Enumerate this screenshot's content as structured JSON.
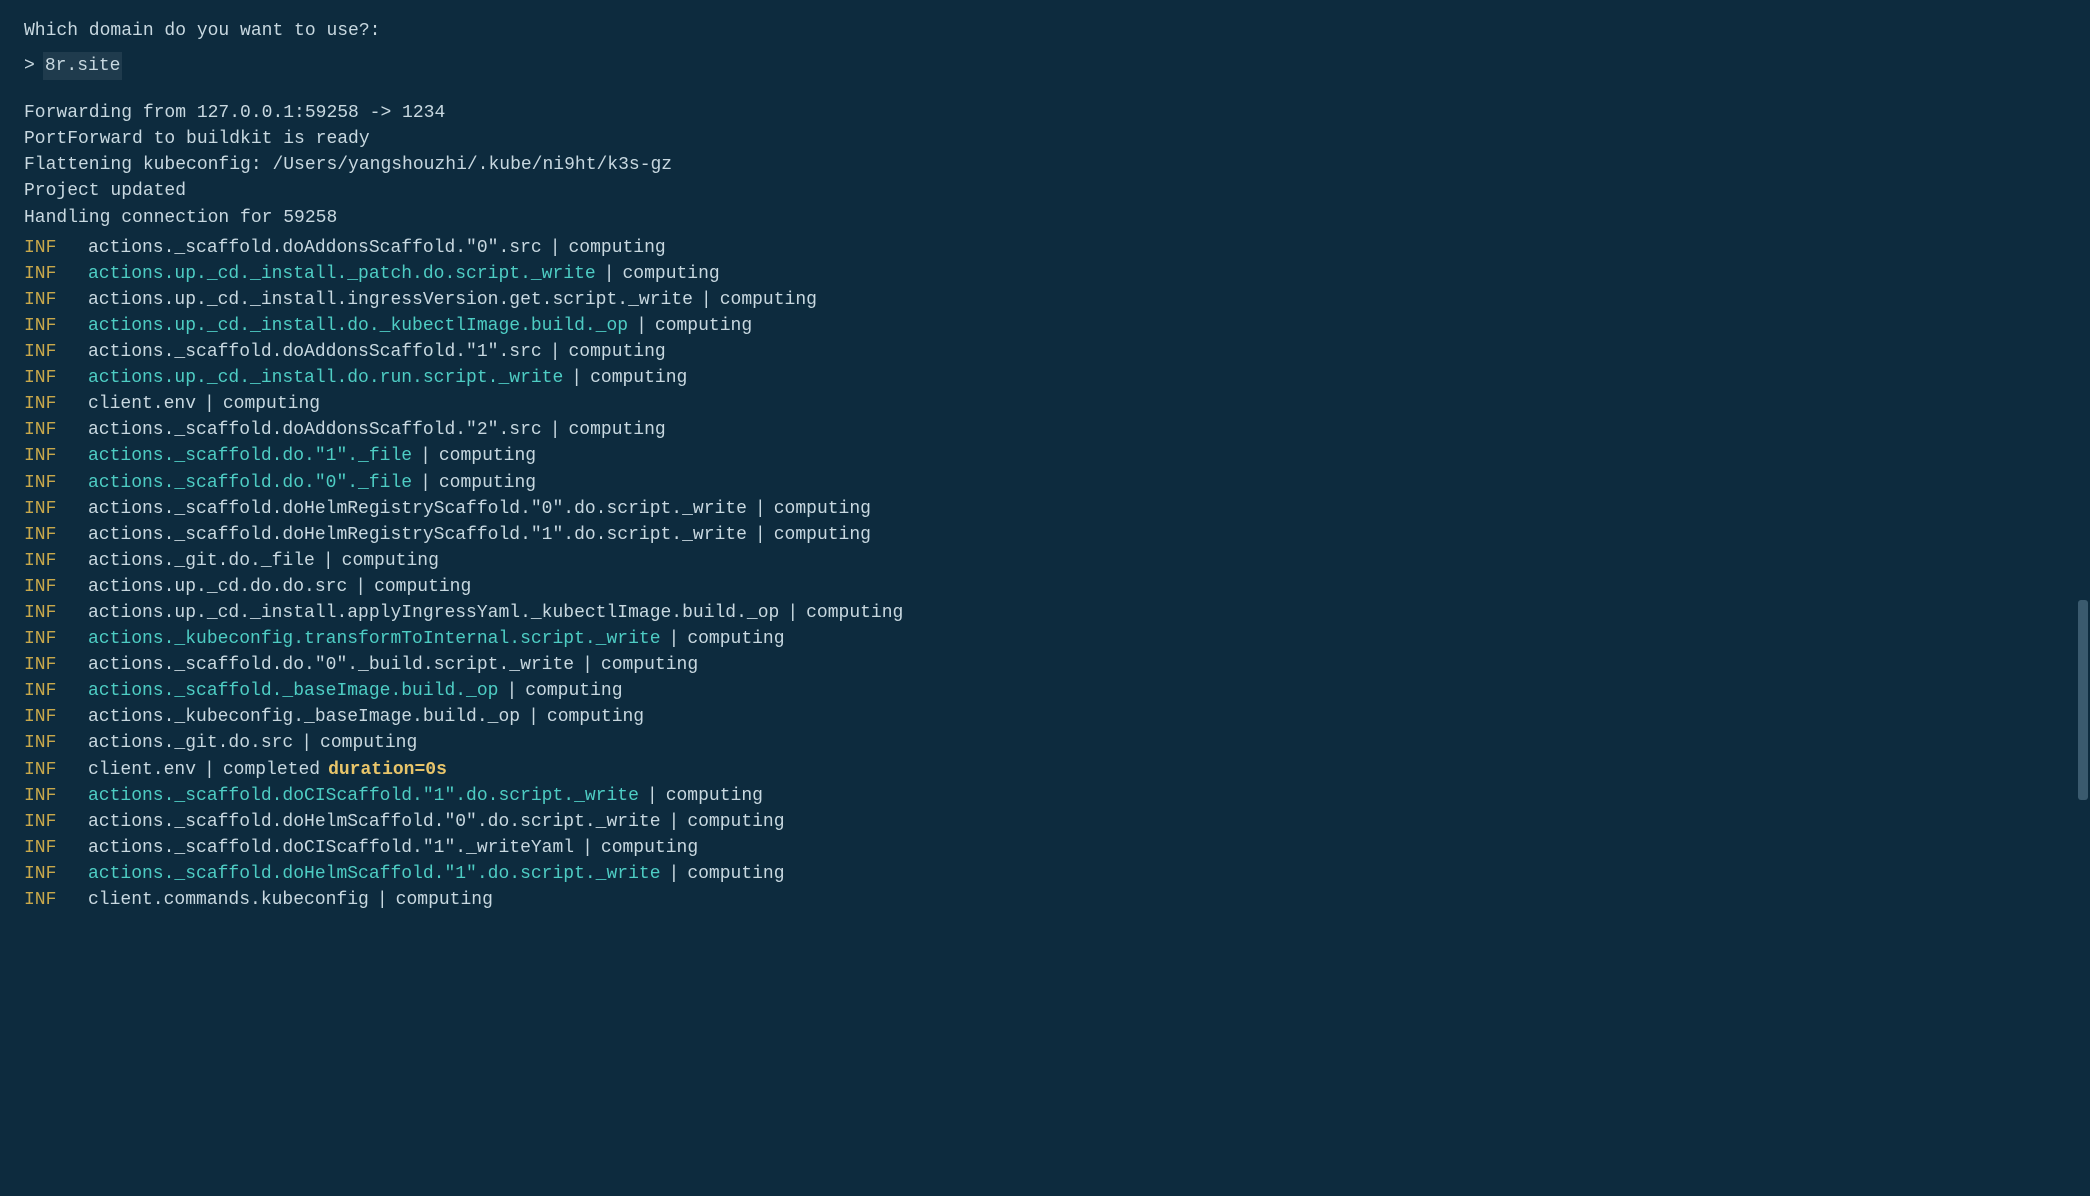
{
  "terminal": {
    "question": "Which domain do you want to use?:",
    "prompt_arrow": ">",
    "prompt_value": "8r.site",
    "status_lines": [
      "Forwarding from 127.0.0.1:59258 -> 1234",
      "PortForward to buildkit is ready",
      "Flattening kubeconfig: /Users/yangshouzhi/.kube/ni9ht/k3s-gz",
      "Project updated",
      "Handling connection for 59258"
    ],
    "log_lines": [
      {
        "level": "INF",
        "action": "actions._scaffold.doAddonsScaffold.\"0\".src",
        "action_color": "white",
        "separator": "|",
        "state": "computing"
      },
      {
        "level": "INF",
        "action": "actions.up._cd._install._patch.do.script._write",
        "action_color": "cyan",
        "separator": "|",
        "state": "computing"
      },
      {
        "level": "INF",
        "action": "actions.up._cd._install.ingressVersion.get.script._write",
        "action_color": "white",
        "separator": "|",
        "state": "computing"
      },
      {
        "level": "INF",
        "action": "actions.up._cd._install.do._kubectlImage.build._op",
        "action_color": "cyan",
        "separator": "|",
        "state": "computing"
      },
      {
        "level": "INF",
        "action": "actions._scaffold.doAddonsScaffold.\"1\".src",
        "action_color": "white",
        "separator": "|",
        "state": "computing"
      },
      {
        "level": "INF",
        "action": "actions.up._cd._install.do.run.script._write",
        "action_color": "cyan",
        "separator": "|",
        "state": "computing"
      },
      {
        "level": "INF",
        "action": "client.env",
        "action_color": "white",
        "separator": "|",
        "state": "computing"
      },
      {
        "level": "INF",
        "action": "actions._scaffold.doAddonsScaffold.\"2\".src",
        "action_color": "white",
        "separator": "|",
        "state": "computing"
      },
      {
        "level": "INF",
        "action": "actions._scaffold.do.\"1\"._file",
        "action_color": "cyan",
        "separator": "|",
        "state": "computing"
      },
      {
        "level": "INF",
        "action": "actions._scaffold.do.\"0\"._file",
        "action_color": "cyan",
        "separator": "|",
        "state": "computing"
      },
      {
        "level": "INF",
        "action": "actions._scaffold.doHelmRegistryScaffold.\"0\".do.script._write",
        "action_color": "white",
        "separator": "|",
        "state": "computing"
      },
      {
        "level": "INF",
        "action": "actions._scaffold.doHelmRegistryScaffold.\"1\".do.script._write",
        "action_color": "white",
        "separator": "|",
        "state": "computing"
      },
      {
        "level": "INF",
        "action": "actions._git.do._file",
        "action_color": "white",
        "separator": "|",
        "state": "computing"
      },
      {
        "level": "INF",
        "action": "actions.up._cd.do.do.src",
        "action_color": "white",
        "separator": "|",
        "state": "computing"
      },
      {
        "level": "INF",
        "action": "actions.up._cd._install.applyIngressYaml._kubectlImage.build._op",
        "action_color": "white",
        "separator": "|",
        "state": "computing"
      },
      {
        "level": "INF",
        "action": "actions._kubeconfig.transformToInternal.script._write",
        "action_color": "cyan",
        "separator": "|",
        "state": "computing"
      },
      {
        "level": "INF",
        "action": "actions._scaffold.do.\"0\"._build.script._write",
        "action_color": "white",
        "separator": "|",
        "state": "computing"
      },
      {
        "level": "INF",
        "action": "actions._scaffold._baseImage.build._op",
        "action_color": "cyan",
        "separator": "|",
        "state": "computing"
      },
      {
        "level": "INF",
        "action": "actions._kubeconfig._baseImage.build._op",
        "action_color": "white",
        "separator": "|",
        "state": "computing"
      },
      {
        "level": "INF",
        "action": "actions._git.do.src",
        "action_color": "white",
        "separator": "|",
        "state": "computing"
      },
      {
        "level": "INF",
        "action": "client.env",
        "action_color": "white",
        "separator": "|",
        "state": "completed",
        "extra": "duration=0s"
      },
      {
        "level": "INF",
        "action": "actions._scaffold.doCIScaffold.\"1\".do.script._write",
        "action_color": "cyan",
        "separator": "|",
        "state": "computing"
      },
      {
        "level": "INF",
        "action": "actions._scaffold.doHelmScaffold.\"0\".do.script._write",
        "action_color": "white",
        "separator": "|",
        "state": "computing"
      },
      {
        "level": "INF",
        "action": "actions._scaffold.doCIScaffold.\"1\"._writeYaml",
        "action_color": "white",
        "separator": "|",
        "state": "computing"
      },
      {
        "level": "INF",
        "action": "actions._scaffold.doHelmScaffold.\"1\".do.script._write",
        "action_color": "cyan",
        "separator": "|",
        "state": "computing"
      },
      {
        "level": "INF",
        "action": "client.commands.kubeconfig",
        "action_color": "white",
        "separator": "|",
        "state": "computing"
      }
    ]
  }
}
